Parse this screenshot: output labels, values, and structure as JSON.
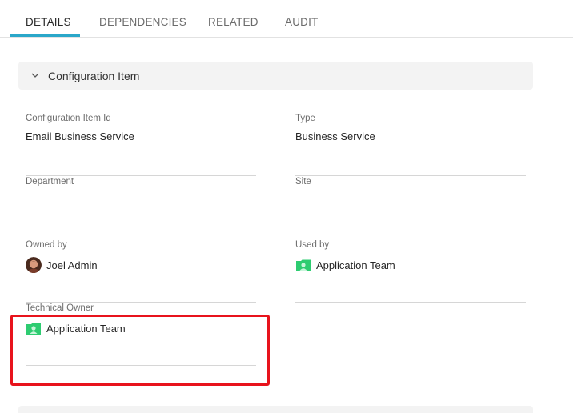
{
  "tabs": [
    {
      "label": "DETAILS",
      "active": true
    },
    {
      "label": "DEPENDENCIES",
      "active": false
    },
    {
      "label": "RELATED",
      "active": false
    },
    {
      "label": "AUDIT",
      "active": false
    }
  ],
  "section": {
    "title": "Configuration Item",
    "icon": "chevron-down-icon"
  },
  "fields": {
    "ci_id": {
      "label": "Configuration Item Id",
      "value": "Email Business Service"
    },
    "type": {
      "label": "Type",
      "value": "Business Service"
    },
    "department": {
      "label": "Department",
      "value": ""
    },
    "site": {
      "label": "Site",
      "value": ""
    },
    "owned_by": {
      "label": "Owned by",
      "value": "Joel Admin",
      "icon": "user-avatar-icon"
    },
    "used_by": {
      "label": "Used by",
      "value": "Application Team",
      "icon": "team-icon"
    },
    "technical_owner": {
      "label": "Technical Owner",
      "value": "Application Team",
      "icon": "team-icon"
    }
  },
  "colors": {
    "accent": "#2aa7c9",
    "highlight": "#e8131c",
    "team_icon": "#2ecc71"
  }
}
